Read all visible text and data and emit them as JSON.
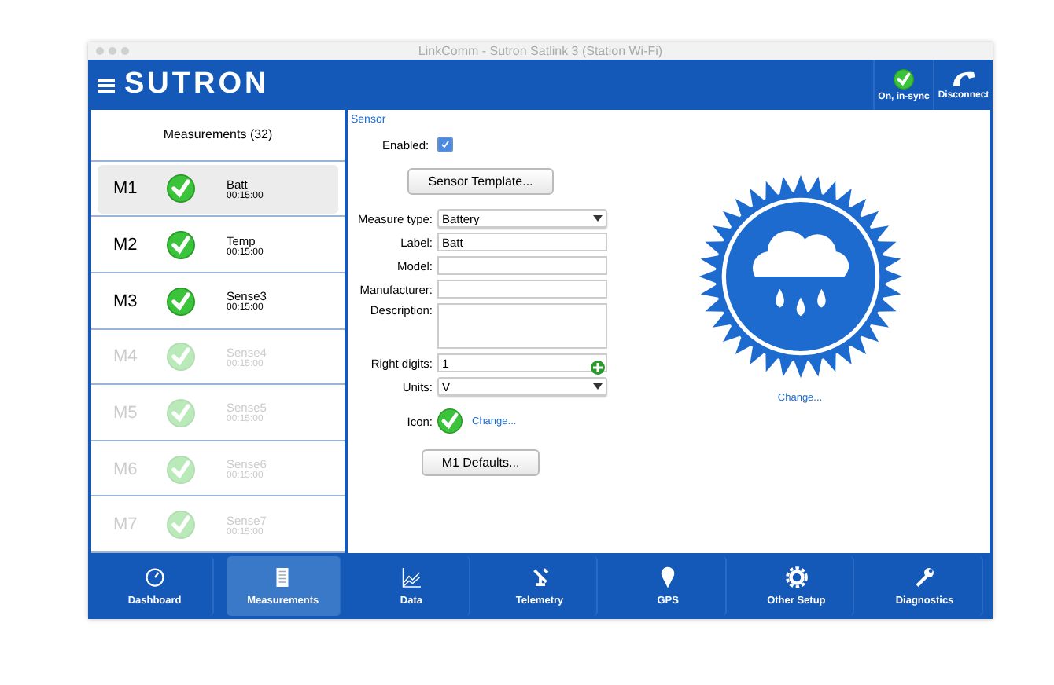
{
  "window": {
    "title": "LinkComm - Sutron Satlink 3 (Station Wi-Fi)"
  },
  "header": {
    "logo": "SUTRON",
    "status": {
      "label": "On, in-sync"
    },
    "disconnect": {
      "label": "Disconnect"
    }
  },
  "measurements": {
    "title": "Measurements (32)",
    "items": [
      {
        "id": "M1",
        "name": "Batt",
        "interval": "00:15:00",
        "enabled": true,
        "selected": true
      },
      {
        "id": "M2",
        "name": "Temp",
        "interval": "00:15:00",
        "enabled": true,
        "selected": false
      },
      {
        "id": "M3",
        "name": "Sense3",
        "interval": "00:15:00",
        "enabled": true,
        "selected": false
      },
      {
        "id": "M4",
        "name": "Sense4",
        "interval": "00:15:00",
        "enabled": false,
        "selected": false
      },
      {
        "id": "M5",
        "name": "Sense5",
        "interval": "00:15:00",
        "enabled": false,
        "selected": false
      },
      {
        "id": "M6",
        "name": "Sense6",
        "interval": "00:15:00",
        "enabled": false,
        "selected": false
      },
      {
        "id": "M7",
        "name": "Sense7",
        "interval": "00:15:00",
        "enabled": false,
        "selected": false
      }
    ]
  },
  "sensor": {
    "section": "Sensor",
    "enabled_label": "Enabled:",
    "enabled": true,
    "template_button": "Sensor Template...",
    "fields": [
      {
        "kind": "select",
        "label": "Measure type:",
        "value": "Battery"
      },
      {
        "kind": "text",
        "label": "Label:",
        "value": "Batt"
      },
      {
        "kind": "text",
        "label": "Model:"
      },
      {
        "kind": "text",
        "label": "Manufacturer:"
      },
      {
        "kind": "area",
        "label": "Description:"
      },
      {
        "kind": "text",
        "label": "Right digits:",
        "value": "1"
      },
      {
        "kind": "combo",
        "label": "Units:",
        "value": "V"
      }
    ],
    "icon_label": "Icon:",
    "icon_change": "Change...",
    "defaults_button": "M1 Defaults...",
    "image_change": "Change..."
  },
  "nav": [
    {
      "label": "Dashboard",
      "selected": false
    },
    {
      "label": "Measurements",
      "selected": true
    },
    {
      "label": "Data",
      "selected": false
    },
    {
      "label": "Telemetry",
      "selected": false
    },
    {
      "label": "GPS",
      "selected": false
    },
    {
      "label": "Other Setup",
      "selected": false
    },
    {
      "label": "Diagnostics",
      "selected": false
    }
  ]
}
